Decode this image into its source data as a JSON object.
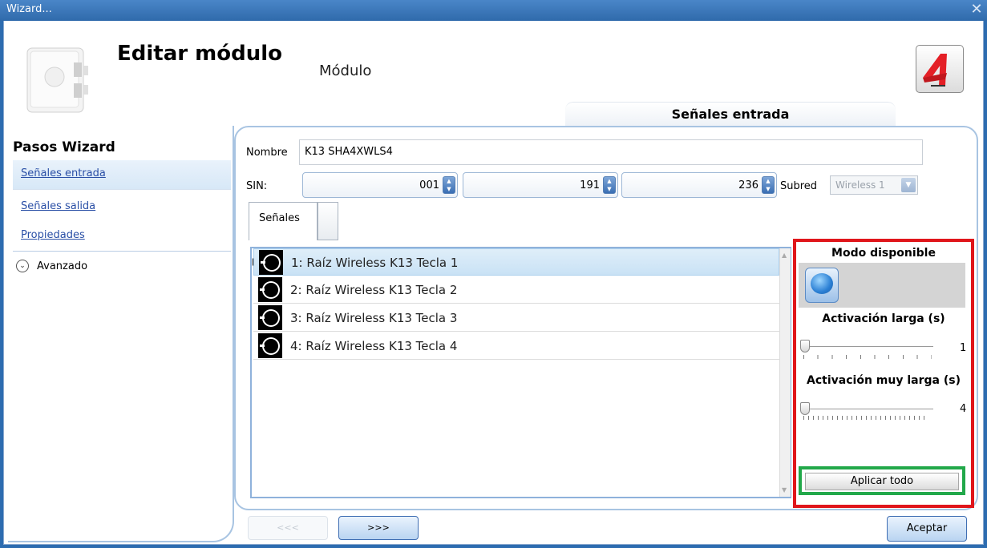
{
  "window": {
    "title": "Wizard...",
    "close_icon": "close-icon"
  },
  "header": {
    "title": "Editar módulo",
    "subtitle": "Módulo",
    "section_tab": "Señales entrada",
    "device_icon": "device-image-icon",
    "logo_icon": "app-logo-icon"
  },
  "sidebar": {
    "title": "Pasos Wizard",
    "steps": [
      {
        "label": "Señales entrada"
      },
      {
        "label": "Señales salida"
      },
      {
        "label": "Propiedades"
      }
    ],
    "advanced": {
      "label": "Avanzado",
      "icon": "chevron-down-icon"
    }
  },
  "form": {
    "name_label": "Nombre",
    "name_value": "K13 SHA4XWLS4",
    "sin_label": "SIN:",
    "sin_values": [
      "001",
      "191",
      "236"
    ],
    "subnet_label": "Subred",
    "subnet_value": "Wireless 1"
  },
  "tabs": [
    {
      "label": "Señales"
    }
  ],
  "signals": [
    {
      "label": "1: Raíz Wireless K13 Tecla 1",
      "icon": "pushbutton-signal-icon"
    },
    {
      "label": "2: Raíz Wireless K13 Tecla 2",
      "icon": "pushbutton-signal-icon"
    },
    {
      "label": "3: Raíz Wireless K13 Tecla 3",
      "icon": "pushbutton-signal-icon"
    },
    {
      "label": "4: Raíz Wireless K13 Tecla 4",
      "icon": "pushbutton-signal-icon"
    }
  ],
  "mode_panel": {
    "title": "Modo disponible",
    "mode_icon": "pushbutton-mode-icon",
    "long_activation_label": "Activación larga (s)",
    "long_activation_value": "1",
    "very_long_activation_label": "Activación muy larga (s)",
    "very_long_activation_value": "4",
    "apply_all_label": "Aplicar todo"
  },
  "footer": {
    "back_label": "<<<",
    "next_label": ">>>",
    "accept_label": "Aceptar"
  },
  "colors": {
    "title_bar": "#2f6aab",
    "highlight_red": "#e0161b",
    "highlight_green": "#22a84a",
    "accent_border": "#a8c4e2"
  }
}
